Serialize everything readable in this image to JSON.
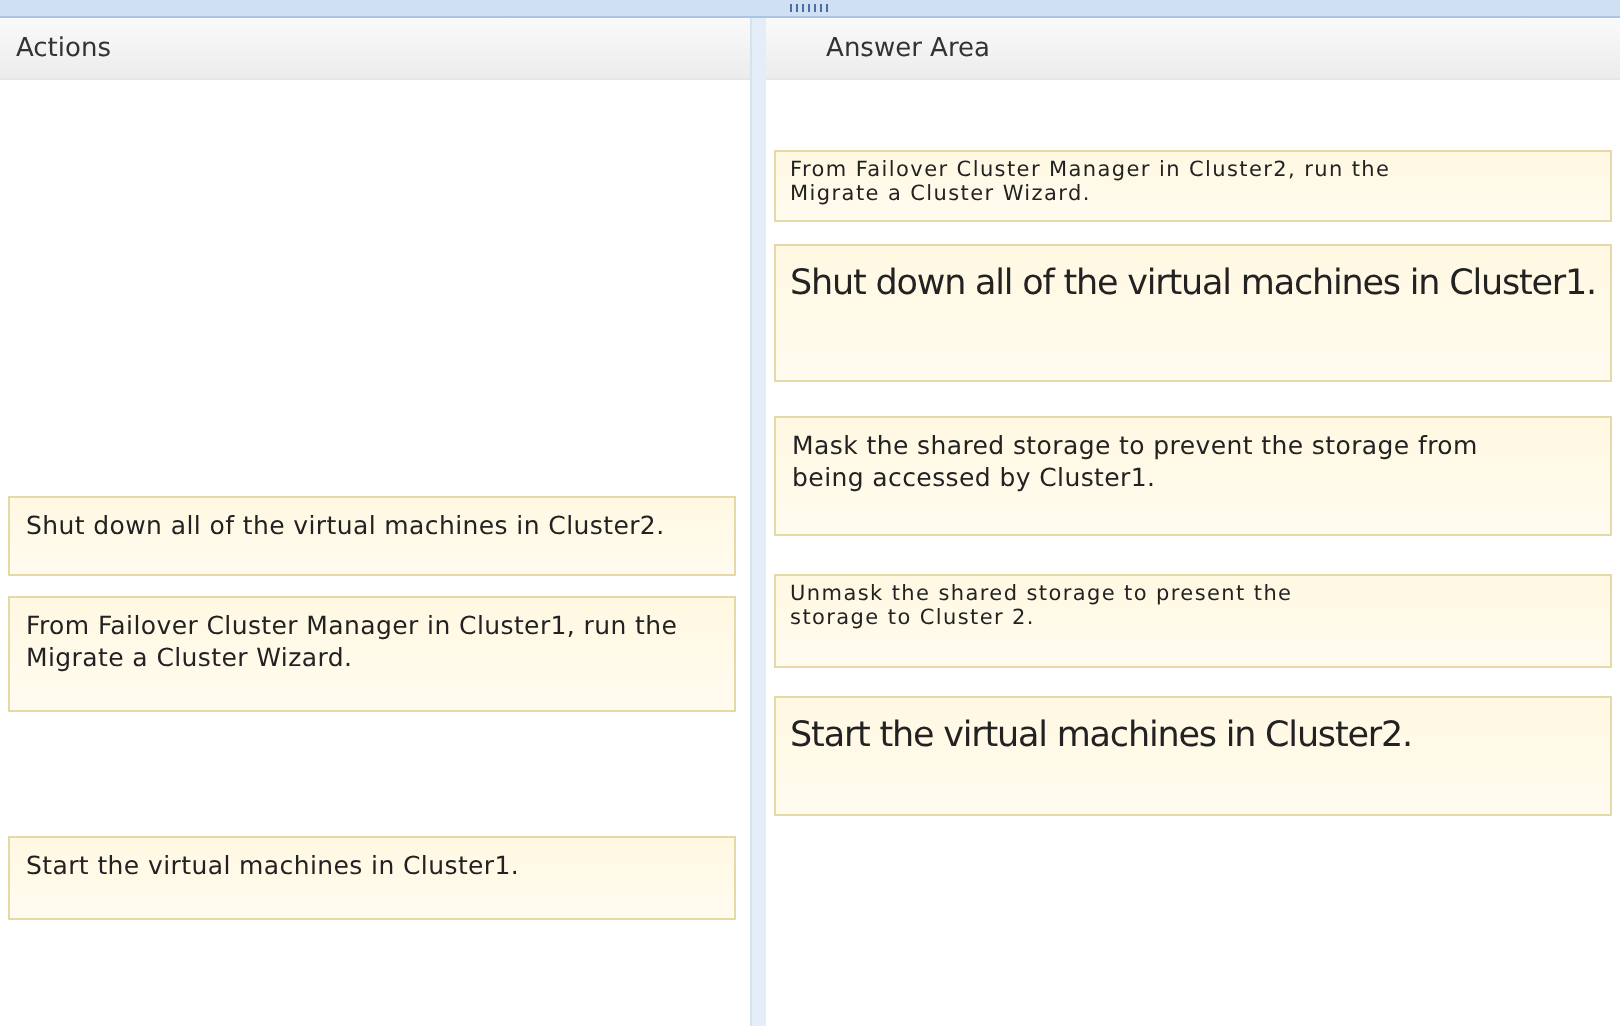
{
  "actions": {
    "title": "Actions",
    "items": [
      {
        "text": "Shut down all of the virtual machines in Cluster2."
      },
      {
        "text": "From Failover Cluster Manager in Cluster1, run the Migrate a Cluster Wizard."
      },
      {
        "text": "Start the virtual machines in Cluster1."
      }
    ]
  },
  "answer_area": {
    "title": "Answer Area",
    "items": [
      {
        "kind": "small",
        "text": "From Failover Cluster Manager in Cluster2, run the Migrate a Cluster Wizard."
      },
      {
        "kind": "large",
        "text": "Shut down all of the virtual machines in Cluster1."
      },
      {
        "kind": "normal",
        "text": "Mask the shared storage to prevent the storage from being accessed by Cluster1."
      },
      {
        "kind": "small",
        "text": "Unmask the shared storage to present the storage to Cluster 2."
      },
      {
        "kind": "large",
        "text": "Start the virtual machines in Cluster2."
      }
    ]
  }
}
